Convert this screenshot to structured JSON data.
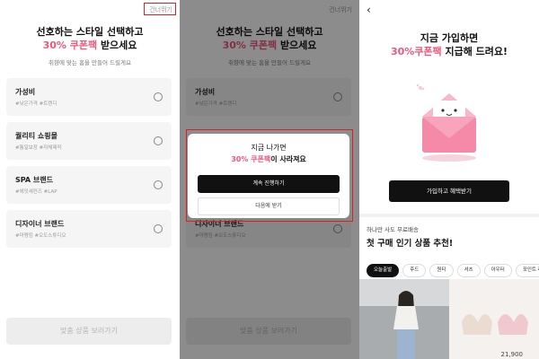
{
  "screen1": {
    "skip_label": "건너뛰기",
    "title_line1": "선호하는 스타일 선택하고",
    "title_highlight": "30% 쿠폰팩",
    "title_suffix": " 받으세요",
    "subtitle": "취향에 맞는 홈을 만들어 드릴게요",
    "options": [
      {
        "name": "가성비",
        "tags": "#낮은가격 #트렌디"
      },
      {
        "name": "퀄리티 쇼핑몰",
        "tags": "#통일보장 #자체제작"
      },
      {
        "name": "SPA 브랜드",
        "tags": "#에잇세컨즈 #LAP"
      },
      {
        "name": "디자이너 브랜드",
        "tags": "#마뗑킴 #오도스튜디오"
      }
    ],
    "bottom_button": "맞춤 상품 보러가기"
  },
  "screen2": {
    "modal_line1": "지금 나가면",
    "modal_highlight": "30% 쿠폰팩",
    "modal_suffix": "이 사라져요",
    "continue_button": "계속 진행하기",
    "later_button": "다음에 받기"
  },
  "screen3": {
    "back_icon": "‹",
    "title_line1": "지금 가입하면",
    "title_highlight": "30%쿠폰팩",
    "title_suffix": " 지급해 드려요!",
    "join_button": "가입하고 혜택받기",
    "sub_label": "하나만 사도 무료배송",
    "section_title": "첫 구매 인기 상품 추천!",
    "chips": [
      "오늘출발",
      "후드",
      "원티",
      "셔츠",
      "아우터",
      "포인트 레"
    ],
    "price_fragment": "21,900"
  },
  "colors": {
    "accent": "#f0557a",
    "highlight_border": "#e02020",
    "primary": "#111111"
  }
}
